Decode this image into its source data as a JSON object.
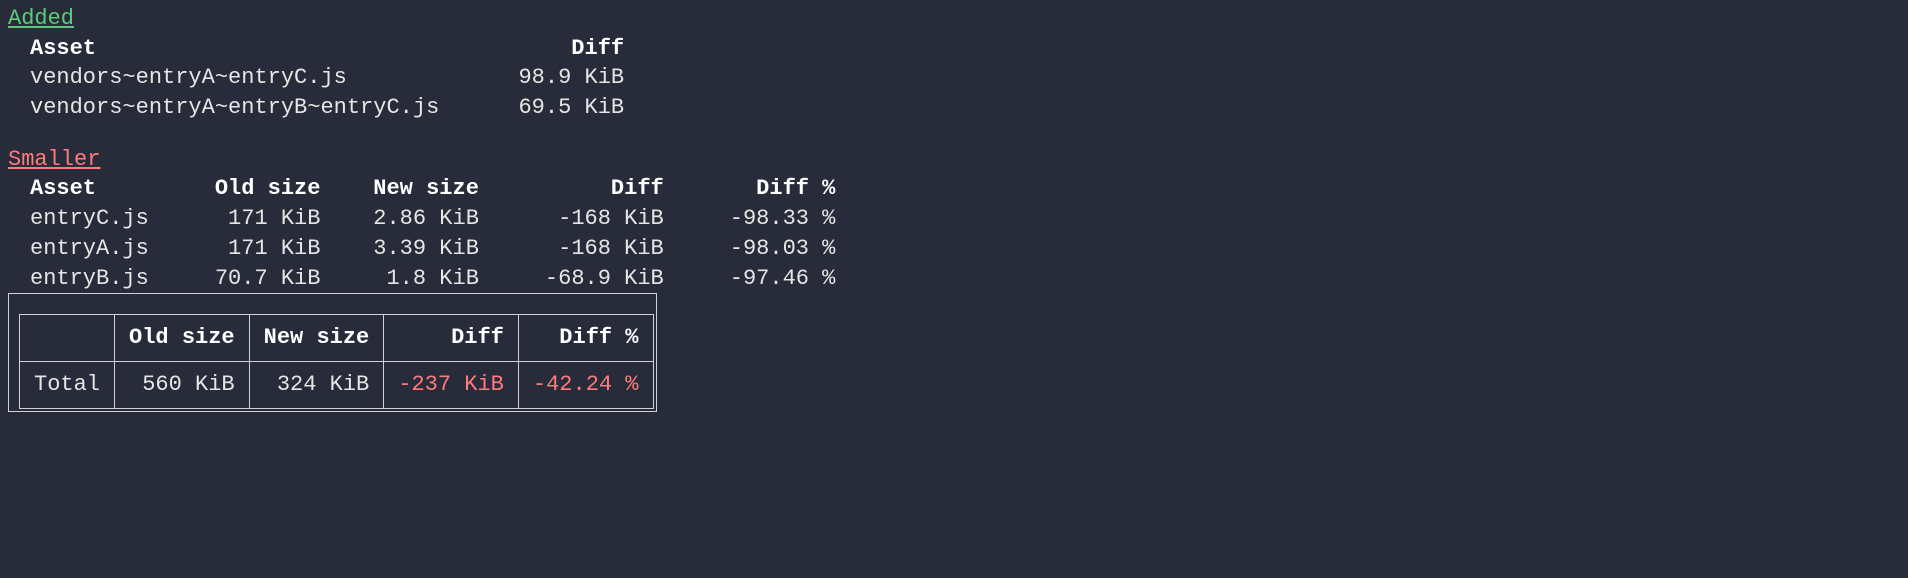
{
  "added": {
    "title": "Added",
    "headers": {
      "asset": "Asset",
      "diff": "Diff"
    },
    "rows": [
      {
        "asset": "vendors~entryA~entryC.js",
        "diff": "98.9 KiB"
      },
      {
        "asset": "vendors~entryA~entryB~entryC.js",
        "diff": "69.5 KiB"
      }
    ]
  },
  "smaller": {
    "title": "Smaller",
    "headers": {
      "asset": "Asset",
      "old": "Old size",
      "new": "New size",
      "diff": "Diff",
      "diffp": "Diff %"
    },
    "rows": [
      {
        "asset": "entryC.js",
        "old": "171 KiB",
        "new": "2.86 KiB",
        "diff": "-168 KiB",
        "diffp": "-98.33 %"
      },
      {
        "asset": "entryA.js",
        "old": "171 KiB",
        "new": "3.39 KiB",
        "diff": "-168 KiB",
        "diffp": "-98.03 %"
      },
      {
        "asset": "entryB.js",
        "old": "70.7 KiB",
        "new": "1.8 KiB",
        "diff": "-68.9 KiB",
        "diffp": "-97.46 %"
      }
    ]
  },
  "summary": {
    "headers": {
      "blank": "",
      "old": "Old size",
      "new": "New size",
      "diff": "Diff",
      "diffp": "Diff %"
    },
    "row": {
      "label": "Total",
      "old": "560 KiB",
      "new": "324 KiB",
      "diff": "-237 KiB",
      "diffp": "-42.24 %"
    }
  }
}
